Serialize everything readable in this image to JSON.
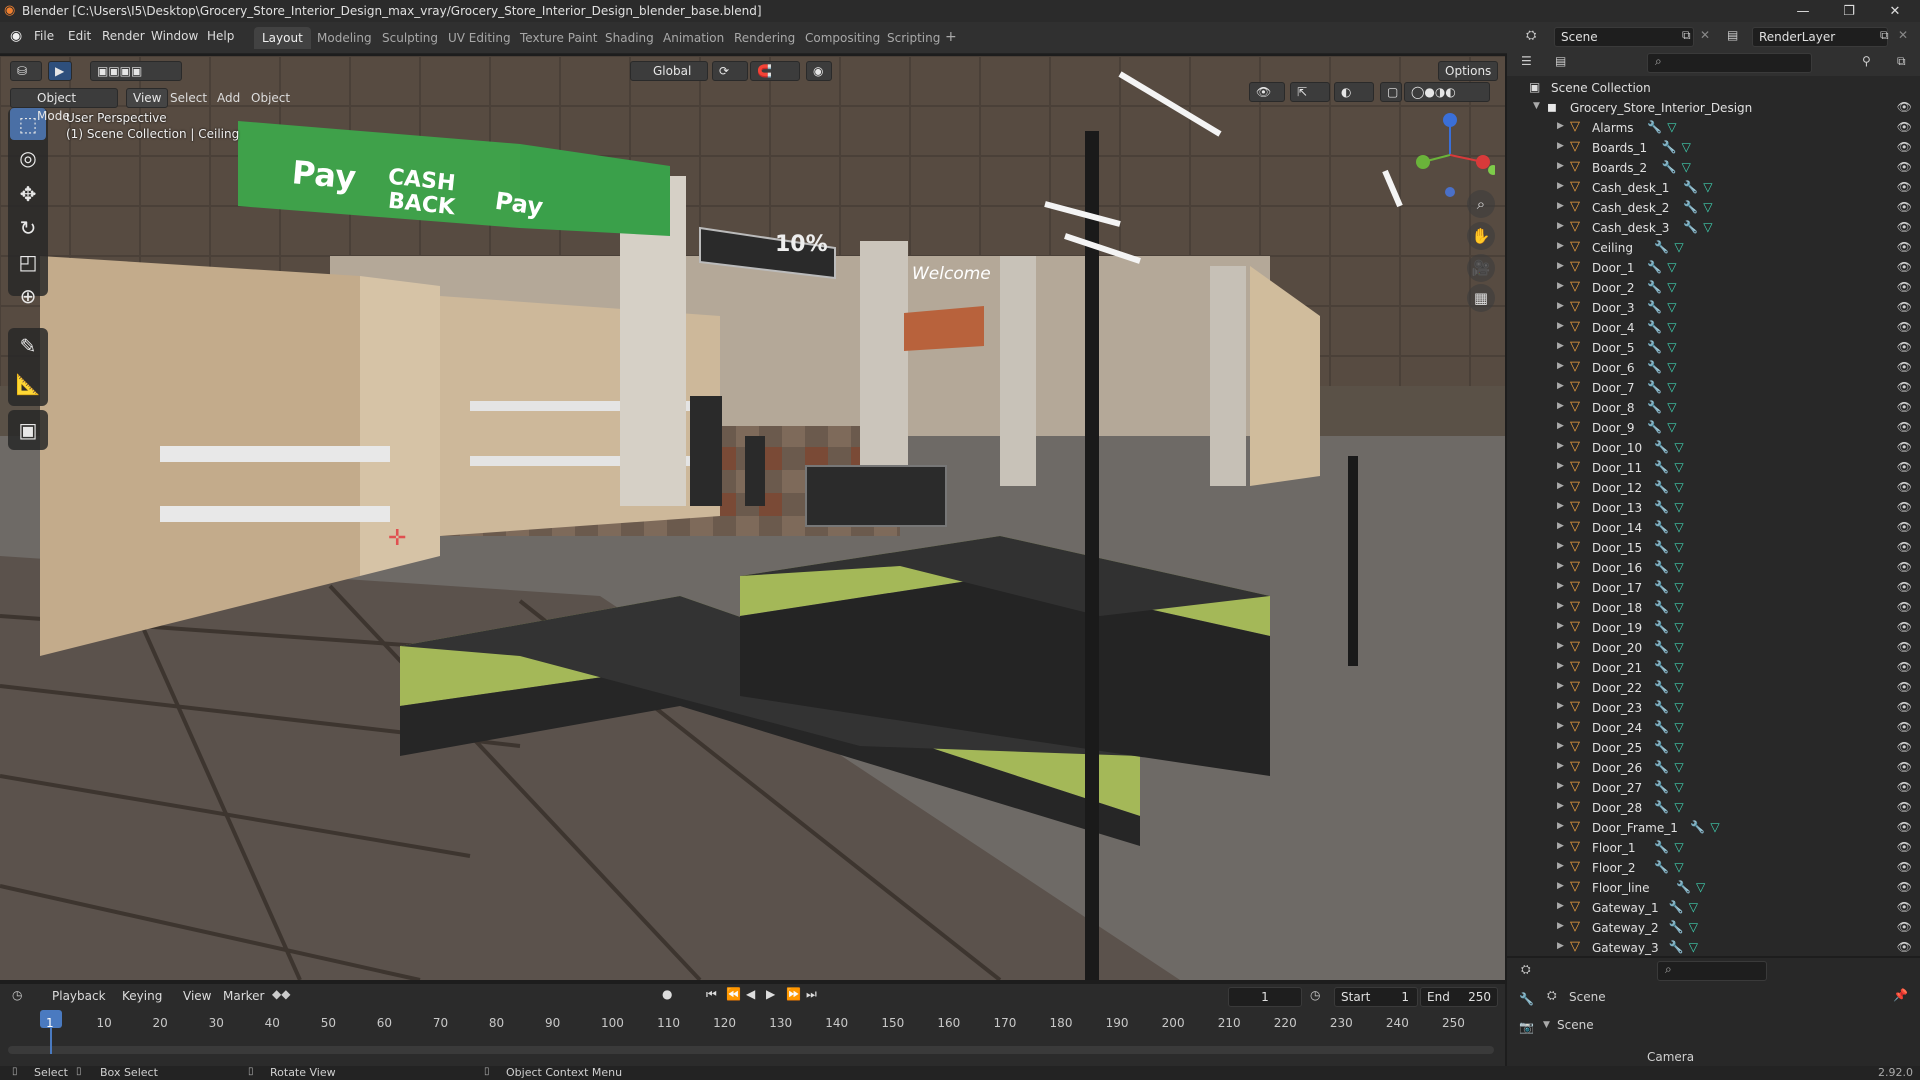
{
  "window": {
    "title": "Blender [C:\\Users\\I5\\Desktop\\Grocery_Store_Interior_Design_max_vray/Grocery_Store_Interior_Design_blender_base.blend]"
  },
  "menu": [
    "File",
    "Edit",
    "Render",
    "Window",
    "Help"
  ],
  "workspaces": [
    "Layout",
    "Modeling",
    "Sculpting",
    "UV Editing",
    "Texture Paint",
    "Shading",
    "Animation",
    "Rendering",
    "Compositing",
    "Scripting"
  ],
  "active_workspace": "Layout",
  "scene_field": "Scene",
  "renderlayer_field": "RenderLayer",
  "viewport": {
    "mode": "Object Mode",
    "menus": [
      "View",
      "Select",
      "Add",
      "Object"
    ],
    "transform_orientation": "Global",
    "options_label": "Options",
    "perspective_label": "User Perspective",
    "collection_label": "(1) Scene Collection | Ceiling"
  },
  "scene_signs": {
    "pay1": "Pay",
    "cashback1": "CASH",
    "cashback2": "BACK",
    "pay2": "Pay",
    "sale": "10%",
    "welcome": "Welcome"
  },
  "outliner": {
    "root": "Scene Collection",
    "collection": "Grocery_Store_Interior_Design",
    "items": [
      "Alarms",
      "Boards_1",
      "Boards_2",
      "Cash_desk_1",
      "Cash_desk_2",
      "Cash_desk_3",
      "Ceiling",
      "Door_1",
      "Door_2",
      "Door_3",
      "Door_4",
      "Door_5",
      "Door_6",
      "Door_7",
      "Door_8",
      "Door_9",
      "Door_10",
      "Door_11",
      "Door_12",
      "Door_13",
      "Door_14",
      "Door_15",
      "Door_16",
      "Door_17",
      "Door_18",
      "Door_19",
      "Door_20",
      "Door_21",
      "Door_22",
      "Door_23",
      "Door_24",
      "Door_25",
      "Door_26",
      "Door_27",
      "Door_28",
      "Door_Frame_1",
      "Floor_1",
      "Floor_2",
      "Floor_line",
      "Gateway_1",
      "Gateway_2",
      "Gateway_3"
    ]
  },
  "properties": {
    "scene_label": "Scene",
    "section_label": "Scene",
    "camera_label": "Camera"
  },
  "timeline": {
    "menus": [
      "Playback",
      "Keying",
      "View",
      "Marker"
    ],
    "current_frame": "1",
    "start_label": "Start",
    "start_value": "1",
    "end_label": "End",
    "end_value": "250",
    "ticks": [
      "1",
      "10",
      "20",
      "30",
      "40",
      "50",
      "60",
      "70",
      "80",
      "90",
      "100",
      "110",
      "120",
      "130",
      "140",
      "150",
      "160",
      "170",
      "180",
      "190",
      "200",
      "210",
      "220",
      "230",
      "240",
      "250"
    ]
  },
  "statusbar": {
    "select": "Select",
    "box_select": "Box Select",
    "rotate_view": "Rotate View",
    "context_menu": "Object Context Menu",
    "version": "2.92.0"
  }
}
